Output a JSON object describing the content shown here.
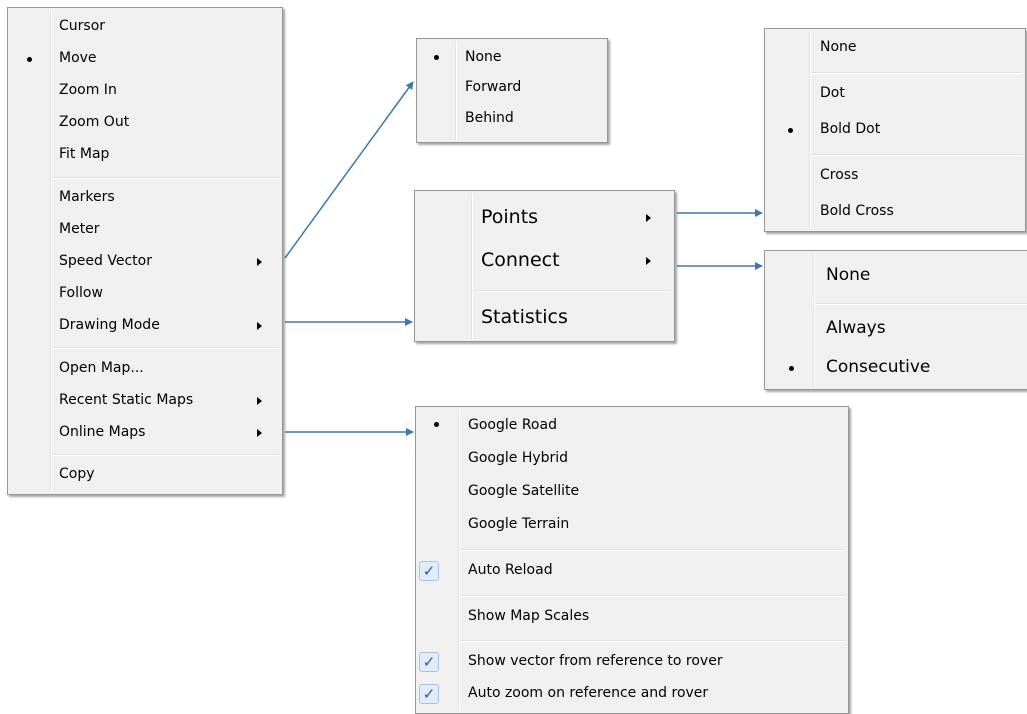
{
  "main_menu": {
    "cursor": "Cursor",
    "move": "Move",
    "zoom_in": "Zoom In",
    "zoom_out": "Zoom Out",
    "fit_map": "Fit Map",
    "markers": "Markers",
    "meter": "Meter",
    "speed_vector": "Speed Vector",
    "follow": "Follow",
    "drawing_mode": "Drawing Mode",
    "open_map": "Open Map...",
    "recent_static_maps": "Recent Static Maps",
    "online_maps": "Online Maps",
    "copy": "Copy",
    "selected": "Move"
  },
  "speed_vector_menu": {
    "none": "None",
    "forward": "Forward",
    "behind": "Behind",
    "selected": "None"
  },
  "drawing_mode_menu": {
    "points": "Points",
    "connect": "Connect",
    "statistics": "Statistics"
  },
  "points_menu": {
    "none": "None",
    "dot": "Dot",
    "bold_dot": "Bold Dot",
    "cross": "Cross",
    "bold_cross": "Bold Cross",
    "selected": "Bold Dot"
  },
  "connect_menu": {
    "none": "None",
    "always": "Always",
    "consecutive": "Consecutive",
    "selected": "Consecutive"
  },
  "online_maps_menu": {
    "google_road": "Google Road",
    "google_hybrid": "Google Hybrid",
    "google_satellite": "Google Satellite",
    "google_terrain": "Google Terrain",
    "auto_reload": "Auto Reload",
    "show_map_scales": "Show Map Scales",
    "show_vector": "Show vector from reference to rover",
    "auto_zoom": "Auto zoom on reference and rover",
    "selected": "Google Road",
    "checked": [
      "Auto Reload",
      "Show vector from reference to rover",
      "Auto zoom on reference and rover"
    ]
  },
  "colors": {
    "menu_bg": "#f0f0f0",
    "connector": "#3a78b0",
    "check_bg": "#e1ecf8"
  },
  "icons": [
    "bullet-icon",
    "submenu-arrow-icon",
    "checkmark-icon",
    "connector-arrow-icon"
  ]
}
